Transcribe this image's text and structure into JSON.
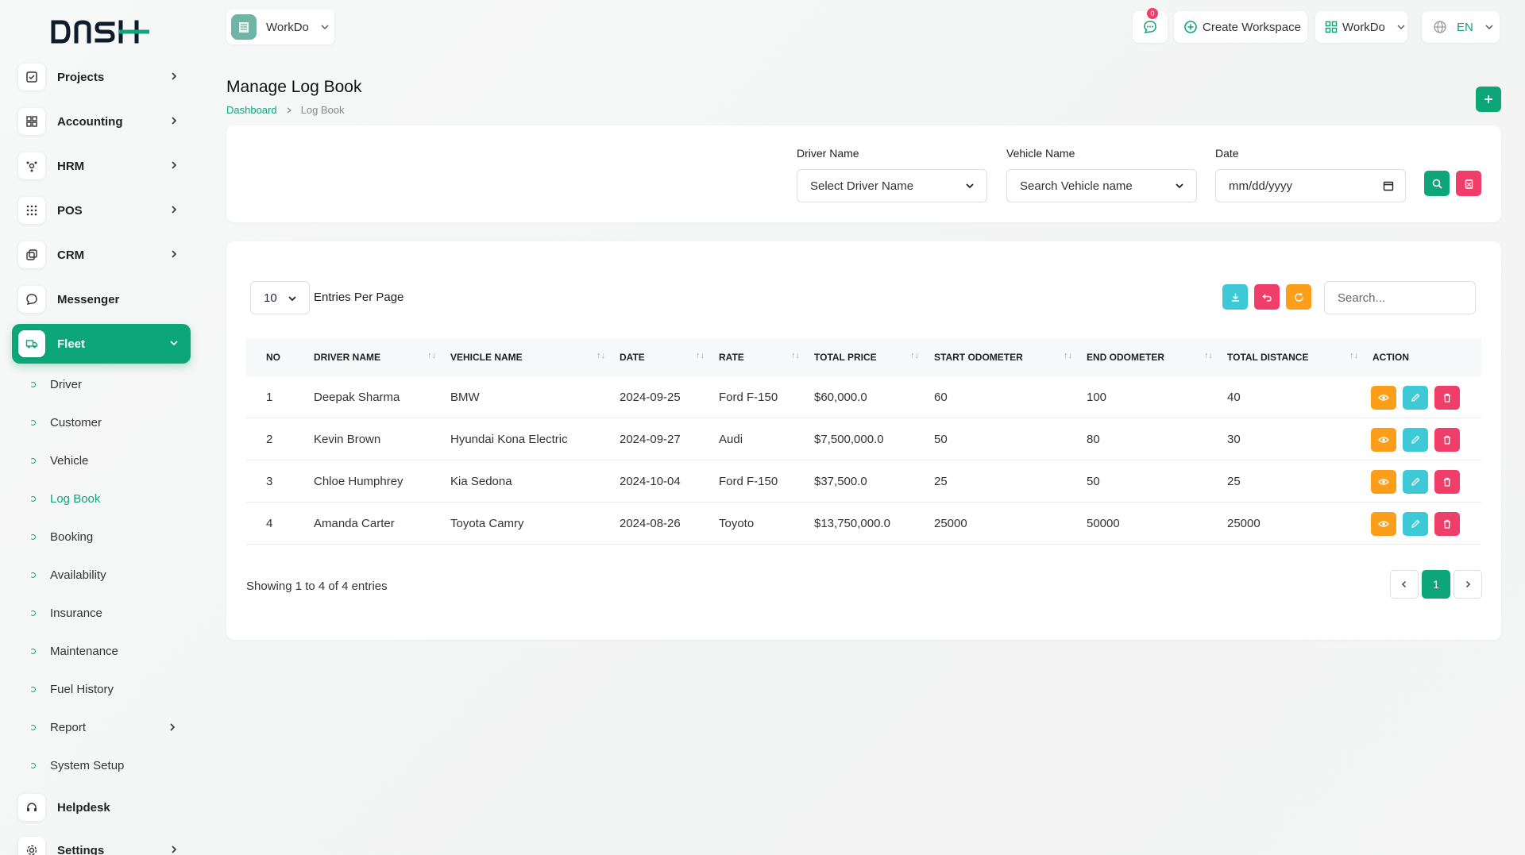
{
  "brand": {
    "logo_text": "DASH"
  },
  "sidebar": {
    "items": [
      {
        "label": "Projects",
        "icon": "check-square-icon"
      },
      {
        "label": "Accounting",
        "icon": "grid-icon"
      },
      {
        "label": "HRM",
        "icon": "users-icon"
      },
      {
        "label": "POS",
        "icon": "dots-grid-icon"
      },
      {
        "label": "CRM",
        "icon": "layers-icon"
      },
      {
        "label": "Messenger",
        "icon": "chat-icon"
      },
      {
        "label": "Fleet",
        "icon": "truck-icon"
      }
    ],
    "fleet_sub": [
      {
        "label": "Driver"
      },
      {
        "label": "Customer"
      },
      {
        "label": "Vehicle"
      },
      {
        "label": "Log Book"
      },
      {
        "label": "Booking"
      },
      {
        "label": "Availability"
      },
      {
        "label": "Insurance"
      },
      {
        "label": "Maintenance"
      },
      {
        "label": "Fuel History"
      },
      {
        "label": "Report"
      },
      {
        "label": "System Setup"
      }
    ],
    "bottom": [
      {
        "label": "Helpdesk",
        "icon": "headset-icon"
      },
      {
        "label": "Settings",
        "icon": "gear-icon"
      }
    ]
  },
  "header": {
    "workspace": "WorkDo",
    "notif_count": "0",
    "create_workspace": "Create Workspace",
    "workspace_menu": "WorkDo",
    "language": "EN"
  },
  "page": {
    "title": "Manage Log Book",
    "breadcrumb_home": "Dashboard",
    "breadcrumb_current": "Log Book"
  },
  "filters": {
    "driver_label": "Driver Name",
    "driver_value": "Select Driver Name",
    "vehicle_label": "Vehicle Name",
    "vehicle_value": "Search Vehicle name",
    "date_label": "Date",
    "date_placeholder": "mm/dd/yyyy"
  },
  "table": {
    "entries_value": "10",
    "entries_label": "Entries Per Page",
    "search_placeholder": "Search...",
    "columns": [
      "NO",
      "DRIVER NAME",
      "VEHICLE NAME",
      "DATE",
      "RATE",
      "TOTAL PRICE",
      "START ODOMETER",
      "END ODOMETER",
      "TOTAL DISTANCE",
      "ACTION"
    ],
    "rows": [
      [
        "1",
        "Deepak Sharma",
        "BMW",
        "2024-09-25",
        "Ford F-150",
        "$60,000.0",
        "60",
        "100",
        "40"
      ],
      [
        "2",
        "Kevin Brown",
        "Hyundai Kona Electric",
        "2024-09-27",
        "Audi",
        "$7,500,000.0",
        "50",
        "80",
        "30"
      ],
      [
        "3",
        "Chloe Humphrey",
        "Kia Sedona",
        "2024-10-04",
        "Ford F-150",
        "$37,500.0",
        "25",
        "50",
        "25"
      ],
      [
        "4",
        "Amanda Carter",
        "Toyota Camry",
        "2024-08-26",
        "Toyoto",
        "$13,750,000.0",
        "25000",
        "50000",
        "25000"
      ]
    ],
    "showing": "Showing 1 to 4 of 4 entries",
    "current_page": "1"
  },
  "colors": {
    "accent": "#0ca678",
    "orange": "#fd9e1b",
    "cyan": "#3ec9d6",
    "pink": "#f03e6a"
  }
}
